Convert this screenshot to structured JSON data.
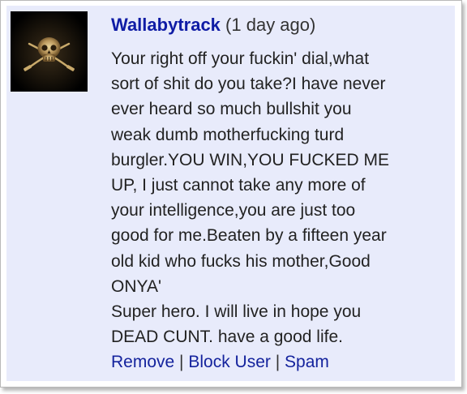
{
  "comment": {
    "username": "Wallabytrack",
    "time": "(1 day ago)",
    "text": "Your right off your fuckin' dial,what\nsort of shit do you take?I have never\never heard so much bullshit you\nweak dumb motherfucking turd\nburgler.YOU WIN,YOU FUCKED ME\nUP, I just cannot take any more of\nyour intelligence,you are just too\ngood for me.Beaten by a fifteen year\nold kid who fucks his mother,Good\nONYA'\nSuper hero. I will live in hope you\nDEAD CUNT. have a good life.",
    "avatar_icon": "pirate-skull-crossed-swords-icon"
  },
  "actions": {
    "remove": "Remove",
    "block_user": "Block User",
    "spam": "Spam",
    "separator": "|"
  },
  "colors": {
    "card_background": "#e8ebfb",
    "username": "#0f1ca5",
    "link": "#14239d",
    "text": "#222222"
  }
}
